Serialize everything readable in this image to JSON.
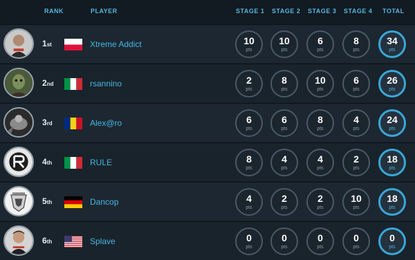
{
  "headers": {
    "rank": "RANK",
    "player": "PLAYER",
    "stage1": "STAGE 1",
    "stage2": "STAGE 2",
    "stage3": "STAGE 3",
    "stage4": "STAGE 4",
    "total": "TOTAL"
  },
  "unit": "pts",
  "rows": [
    {
      "rank": "1",
      "suffix": "st",
      "flag": "poland-flag-icon",
      "name": "Xtreme Addict",
      "stages": [
        "10",
        "10",
        "6",
        "8"
      ],
      "total": "34"
    },
    {
      "rank": "2",
      "suffix": "nd",
      "flag": "italy-flag-icon",
      "name": "rsannino",
      "stages": [
        "2",
        "8",
        "10",
        "6"
      ],
      "total": "26"
    },
    {
      "rank": "3",
      "suffix": "rd",
      "flag": "romania-flag-icon",
      "name": "Alex@ro",
      "stages": [
        "6",
        "6",
        "8",
        "4"
      ],
      "total": "24"
    },
    {
      "rank": "4",
      "suffix": "th",
      "flag": "italy-flag-icon",
      "name": "RULE",
      "stages": [
        "8",
        "4",
        "4",
        "2"
      ],
      "total": "18"
    },
    {
      "rank": "5",
      "suffix": "th",
      "flag": "germany-flag-icon",
      "name": "Dancop",
      "stages": [
        "4",
        "2",
        "2",
        "10"
      ],
      "total": "18"
    },
    {
      "rank": "6",
      "suffix": "th",
      "flag": "usa-flag-icon",
      "name": "Splave",
      "stages": [
        "0",
        "0",
        "0",
        "0"
      ],
      "total": "0"
    }
  ],
  "colors": {
    "accent": "#46b6e2",
    "header_text": "#56b6da",
    "background": "#172029",
    "total_ring": "#3aa7d8"
  }
}
